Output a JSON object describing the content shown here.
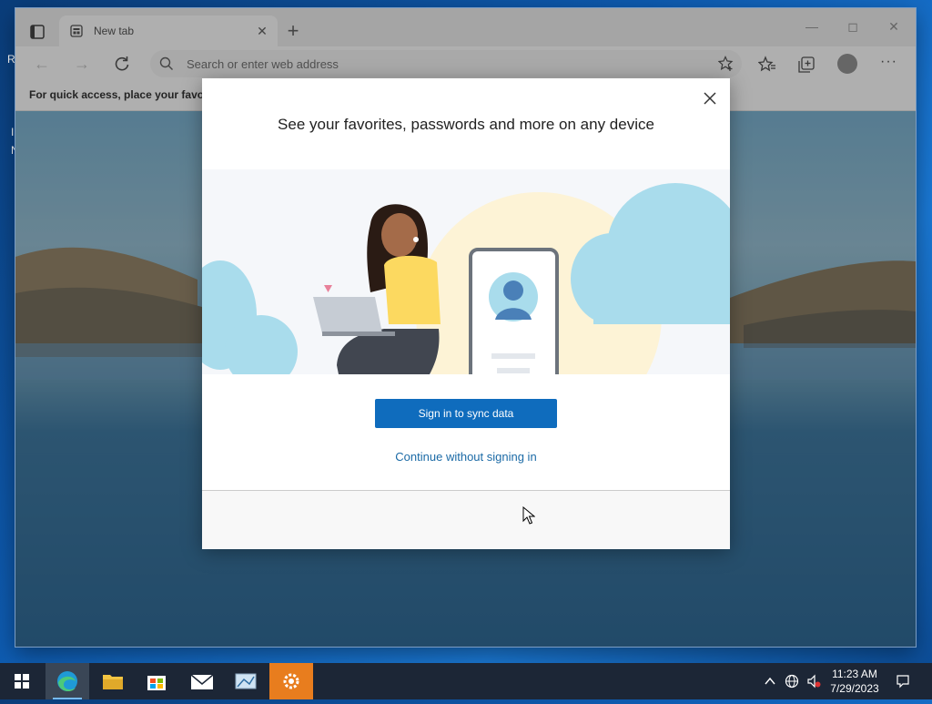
{
  "desktop": {
    "left_chars": [
      "R",
      "I",
      "N"
    ]
  },
  "browser": {
    "tab": {
      "title": "New tab"
    },
    "address_placeholder": "Search or enter web address",
    "favbar_text": "For quick access, place your favorit"
  },
  "dialog": {
    "title": "See your favorites, passwords and more on any device",
    "primary_button": "Sign in to sync data",
    "secondary_link": "Continue without signing in"
  },
  "taskbar": {
    "apps": [
      "start-icon",
      "edge-icon",
      "file-explorer-icon",
      "store-icon",
      "mail-icon",
      "control-panel-icon",
      "settings-icon"
    ],
    "time": "11:23 AM",
    "date": "7/29/2023"
  },
  "colors": {
    "accent": "#0f6cbd",
    "link": "#1b6aa6",
    "taskbar": "#1c2636"
  }
}
